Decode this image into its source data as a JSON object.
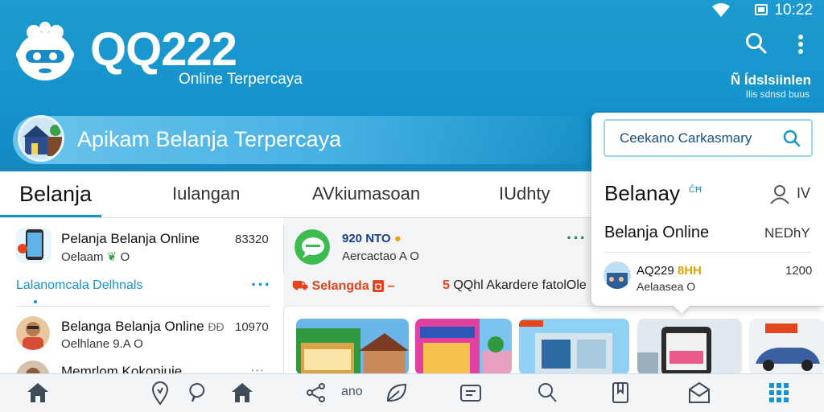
{
  "status_bar": {
    "time": "10:22"
  },
  "header": {
    "brand": "QQ222",
    "tagline": "Online Terpercaya",
    "top_right_line1": "Ñ Ídslsiinlen",
    "top_right_line2": "Ilis sdnsd buus",
    "banner_text": "Apikam Belanja Terpercaya"
  },
  "tabs": [
    {
      "label": "Belanja",
      "active": true
    },
    {
      "label": "Iulangan",
      "active": false
    },
    {
      "label": "AVkiumasoan",
      "active": false
    },
    {
      "label": "IUdhty",
      "active": false
    }
  ],
  "left_list": {
    "row1": {
      "title": "Pelanja Belanja Online",
      "sub": "Oelaam",
      "sub_suffix": "O",
      "number": "83320"
    },
    "section_label": "Lalanomcala Delhnals",
    "row2": {
      "title": "Belanga Belanja Online",
      "title_badge": "ĐĐ",
      "sub": "Oelhlane 9.A",
      "sub_suffix": "O",
      "number": "10970"
    },
    "row3": {
      "title": "Memrlom Kokoniuie"
    }
  },
  "middle": {
    "title": "920 NTO",
    "sub": "Aercactao A",
    "sub_suffix": "O",
    "promo_red": "Selangda",
    "promo_red_suffix": "–",
    "promo_prefix": "5",
    "promo_text": "QQhl Akardere fatolOle"
  },
  "dropdown": {
    "search_placeholder": "Ceekano Carkasmary",
    "title": "Belanay",
    "title_badge": "ĈĦ",
    "user_label": "IV",
    "item1": "Belanja Online",
    "item1_right": "NEDhY",
    "row": {
      "title": "AQ229",
      "tag": "8HH",
      "sub": "Aelaasea",
      "sub_suffix": "O",
      "number": "1200"
    }
  },
  "bottom_nav": {
    "text_item": "ano"
  },
  "colors": {
    "primary": "#1593cb",
    "accent": "#e2461f",
    "text": "#111111"
  },
  "icons": [
    "logo-icon",
    "search-icon",
    "more-icon",
    "home-icon",
    "location-icon",
    "chat-icon",
    "share-icon",
    "leaf-icon",
    "wallet-icon",
    "bookmark-icon",
    "mail-icon",
    "grid-icon",
    "user-icon"
  ]
}
